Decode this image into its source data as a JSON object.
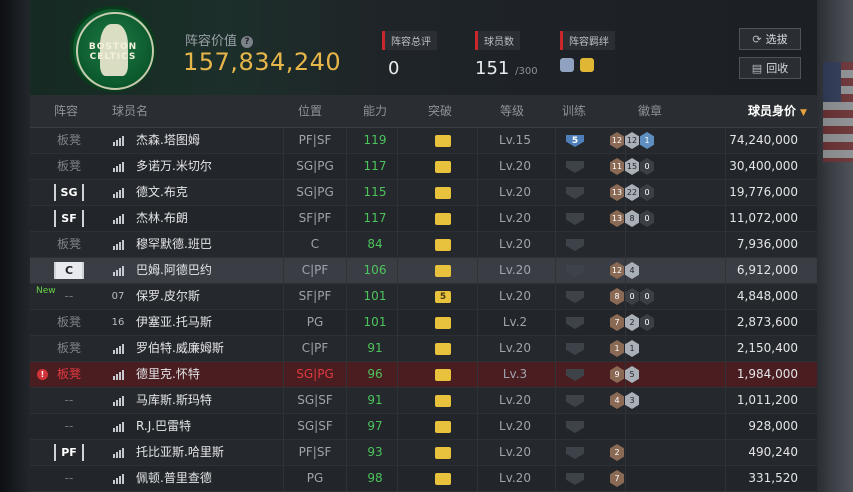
{
  "header": {
    "logo_text": "BOSTON CELTICS",
    "value_label": "阵容价值",
    "value": "157,834,240",
    "overall_label": "阵容总评",
    "overall_value": "0",
    "count_label": "球员数",
    "count_value": "151",
    "count_max": "/300",
    "synergy_label": "阵容羁绊",
    "btn_filter": "选拔",
    "btn_recycle": "回收"
  },
  "columns": {
    "lineup": "阵容",
    "name": "球员名",
    "position": "位置",
    "ability": "能力",
    "breakthrough": "突破",
    "level": "等级",
    "training": "训练",
    "badges": "徽章",
    "price": "球员身价"
  },
  "rows": [
    {
      "lineup": "板凳",
      "name": "杰森.塔图姆",
      "pos": "PF|SF",
      "ovr": "119",
      "crown": "",
      "lvl": "Lv.15",
      "train": "5",
      "badges": [
        "12",
        "12",
        "1"
      ],
      "price": "74,240,000"
    },
    {
      "lineup": "板凳",
      "name": "多诺万.米切尔",
      "pos": "SG|PG",
      "ovr": "117",
      "crown": "",
      "lvl": "Lv.20",
      "train": "",
      "badges": [
        "11",
        "15",
        "0"
      ],
      "price": "30,400,000"
    },
    {
      "lineup": "SG",
      "name": "德文.布克",
      "pos": "SG|PG",
      "ovr": "115",
      "crown": "",
      "lvl": "Lv.20",
      "train": "",
      "badges": [
        "13",
        "22",
        "0"
      ],
      "price": "19,776,000"
    },
    {
      "lineup": "SF",
      "name": "杰林.布朗",
      "pos": "SF|PF",
      "ovr": "117",
      "crown": "",
      "lvl": "Lv.20",
      "train": "",
      "badges": [
        "13",
        "8",
        "0"
      ],
      "price": "11,072,000"
    },
    {
      "lineup": "板凳",
      "name": "穆罕默德.班巴",
      "pos": "C",
      "ovr": "84",
      "crown": "",
      "lvl": "Lv.20",
      "train": "",
      "badges": [],
      "price": "7,936,000"
    },
    {
      "lineup": "C",
      "name": "巴姆.阿德巴约",
      "pos": "C|PF",
      "ovr": "106",
      "crown": "",
      "lvl": "Lv.20",
      "train": "",
      "badges": [
        "12",
        "4"
      ],
      "price": "6,912,000"
    },
    {
      "lineup": "--",
      "new": "New",
      "jersey": "07",
      "name": "保罗.皮尔斯",
      "pos": "SF|PF",
      "ovr": "101",
      "crown": "5",
      "lvl": "Lv.20",
      "train": "",
      "badges": [
        "8",
        "0",
        "0"
      ],
      "price": "4,848,000"
    },
    {
      "lineup": "板凳",
      "jersey": "16",
      "name": "伊塞亚.托马斯",
      "pos": "PG",
      "ovr": "101",
      "crown": "",
      "lvl": "Lv.2",
      "train": "",
      "badges": [
        "7",
        "2",
        "0"
      ],
      "price": "2,873,600"
    },
    {
      "lineup": "板凳",
      "name": "罗伯特.威廉姆斯",
      "pos": "C|PF",
      "ovr": "91",
      "crown": "",
      "lvl": "Lv.20",
      "train": "",
      "badges": [
        "1",
        "1"
      ],
      "price": "2,150,400"
    },
    {
      "lineup": "板凳",
      "warn": "!",
      "name": "德里克.怀特",
      "pos": "SG|PG",
      "ovr": "96",
      "crown": "",
      "lvl": "Lv.3",
      "train": "",
      "badges": [
        "9",
        "5"
      ],
      "price": "1,984,000"
    },
    {
      "lineup": "--",
      "name": "马库斯.斯玛特",
      "pos": "SG|SF",
      "ovr": "91",
      "crown": "",
      "lvl": "Lv.20",
      "train": "",
      "badges": [
        "4",
        "3"
      ],
      "price": "1,011,200"
    },
    {
      "lineup": "--",
      "name": "R.J.巴雷特",
      "pos": "SG|SF",
      "ovr": "97",
      "crown": "",
      "lvl": "Lv.20",
      "train": "",
      "badges": [],
      "price": "928,000"
    },
    {
      "lineup": "PF",
      "name": "托比亚斯.哈里斯",
      "pos": "PF|SF",
      "ovr": "93",
      "crown": "",
      "lvl": "Lv.20",
      "train": "",
      "badges": [
        "2"
      ],
      "price": "490,240"
    },
    {
      "lineup": "--",
      "name": "佩顿.普里查德",
      "pos": "PG",
      "ovr": "98",
      "crown": "",
      "lvl": "Lv.20",
      "train": "",
      "badges": [
        "7"
      ],
      "price": "331,520"
    }
  ],
  "colors": {
    "accent_gold": "#e7b64a",
    "rating_green": "#4cc45c",
    "alert_red": "#c8282c"
  }
}
